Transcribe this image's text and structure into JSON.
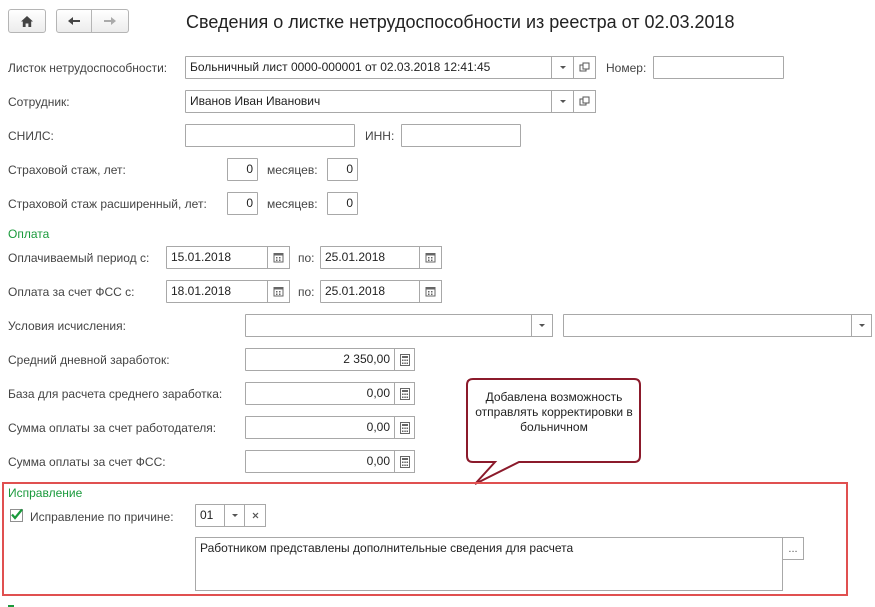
{
  "header": {
    "title": "Сведения о листке нетрудоспособности  из реестра от 02.03.2018"
  },
  "fields": {
    "sick_leave": {
      "label": "Листок нетрудоспособности:",
      "value": "Больничный лист 0000-000001 от 02.03.2018 12:41:45"
    },
    "number": {
      "label": "Номер:",
      "value": ""
    },
    "employee": {
      "label": "Сотрудник:",
      "value": "Иванов Иван Иванович"
    },
    "snils": {
      "label": "СНИЛС:",
      "value": ""
    },
    "inn": {
      "label": "ИНН:",
      "value": ""
    },
    "insurance_years": {
      "label": "Страховой стаж, лет:",
      "value": "0",
      "months_label": "месяцев:",
      "months_value": "0"
    },
    "insurance_ext_years": {
      "label": "Страховой стаж расширенный, лет:",
      "value": "0",
      "months_label": "месяцев:",
      "months_value": "0"
    }
  },
  "payment": {
    "section_title": "Оплата",
    "paid_period": {
      "label": "Оплачиваемый период с:",
      "from": "15.01.2018",
      "to_label": "по:",
      "to": "25.01.2018"
    },
    "fss_payment": {
      "label": "Оплата за счет ФСС с:",
      "from": "18.01.2018",
      "to_label": "по:",
      "to": "25.01.2018"
    },
    "calc_conditions": {
      "label": "Условия исчисления:",
      "value1": "",
      "value2": ""
    },
    "avg_daily": {
      "label": "Средний дневной заработок:",
      "value": "2 350,00"
    },
    "avg_base": {
      "label": "База для расчета среднего заработка:",
      "value": "0,00"
    },
    "employer_sum": {
      "label": "Сумма оплаты за счет работодателя:",
      "value": "0,00"
    },
    "fss_sum": {
      "label": "Сумма оплаты за счет ФСС:",
      "value": "0,00"
    }
  },
  "correction": {
    "section_title": "Исправление",
    "checkbox_label": "Исправление по причине:",
    "checked": true,
    "reason_code": "01",
    "reason_text": "Работником представлены дополнительные сведения для расчета",
    "more_label": "..."
  },
  "callout": {
    "text": "Добавлена возможность отправлять корректировки в больничном"
  },
  "colors": {
    "section_green": "#1a9a3c",
    "highlight_red": "#e05050",
    "callout_border": "#8b1a2b"
  }
}
